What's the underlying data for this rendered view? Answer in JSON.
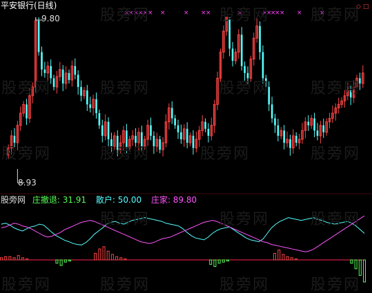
{
  "header": {
    "title": "平安银行(日线)",
    "title_color": "#ffffff"
  },
  "watermark": "股旁网",
  "price_chart": {
    "type": "candlestick",
    "high_label": "9.80",
    "low_label": "8.93",
    "up_color": "#ff4444",
    "down_color": "#55ffff",
    "markers": [
      "×",
      "◇",
      "□"
    ],
    "marker_color": "#ff44ff"
  },
  "indicator_panel": {
    "name": "股旁网",
    "items": [
      {
        "label": "庄撤退: 31.91",
        "color": "#55ff55"
      },
      {
        "label": "散户: 50.00",
        "color": "#55ffff"
      },
      {
        "label": "庄家: 89.80",
        "color": "#ff55ff"
      }
    ],
    "baseline_color": "#ff2255"
  },
  "chart_data": [
    {
      "type": "candlestick",
      "title": "平安银行(日线)",
      "annotations": [
        {
          "text": "9.80",
          "value": 9.8,
          "kind": "high"
        },
        {
          "text": "8.93",
          "value": 8.93,
          "kind": "low"
        }
      ],
      "close": [
        9.05,
        9.12,
        9.08,
        9.18,
        9.25,
        9.3,
        9.22,
        9.35,
        9.4,
        9.78,
        9.6,
        9.5,
        9.48,
        9.52,
        9.45,
        9.4,
        9.46,
        9.5,
        9.42,
        9.48,
        9.44,
        9.52,
        9.47,
        9.4,
        9.35,
        9.38,
        9.3,
        9.28,
        9.33,
        9.25,
        9.18,
        9.12,
        9.2,
        9.1,
        9.06,
        9.12,
        9.04,
        9.08,
        9.15,
        9.05,
        9.1,
        9.12,
        9.08,
        9.14,
        9.06,
        9.1,
        9.18,
        9.12,
        9.06,
        9.1,
        9.04,
        9.08,
        9.2,
        9.28,
        9.22,
        9.18,
        9.14,
        9.1,
        9.16,
        9.08,
        9.12,
        9.05,
        9.1,
        9.15,
        9.2,
        9.16,
        9.12,
        9.18,
        9.3,
        9.45,
        9.6,
        9.72,
        9.8,
        9.62,
        9.55,
        9.6,
        9.7,
        9.52,
        9.48,
        9.45,
        9.56,
        9.68,
        9.75,
        9.6,
        9.45,
        9.4,
        9.3,
        9.22,
        9.18,
        9.12,
        9.15,
        9.08,
        9.1,
        9.05,
        9.12,
        9.08,
        9.1,
        9.15,
        9.2,
        9.18,
        9.22,
        9.15,
        9.12,
        9.18,
        9.14,
        9.2,
        9.22,
        9.25,
        9.28,
        9.3,
        9.32,
        9.35,
        9.38,
        9.34,
        9.4,
        9.45,
        9.42,
        9.48
      ]
    },
    {
      "type": "line",
      "series": [
        {
          "name": "散户",
          "color": "#55ffff",
          "last": 50.0,
          "values": [
            70,
            72,
            68,
            62,
            58,
            55,
            60,
            64,
            66,
            70,
            68,
            60,
            52,
            45,
            40,
            35,
            32,
            28,
            26,
            25,
            30,
            38,
            48,
            55,
            62,
            70,
            74,
            76,
            72,
            70,
            74,
            78,
            80,
            82,
            84,
            82,
            80,
            78,
            76,
            72,
            70,
            68,
            66,
            60,
            52,
            45,
            40,
            38,
            36,
            42,
            50,
            56,
            60,
            62,
            64,
            58,
            52,
            46,
            40,
            36,
            34,
            32,
            38,
            50,
            62,
            70,
            76,
            80,
            84,
            82,
            80,
            78,
            80,
            82,
            84,
            80,
            78,
            74,
            72,
            70,
            72,
            74,
            76,
            72,
            66,
            58,
            50
          ]
        },
        {
          "name": "庄家",
          "color": "#ff55ff",
          "last": 89.8,
          "values": [
            62,
            64,
            68,
            72,
            70,
            66,
            64,
            60,
            55,
            50,
            45,
            42,
            44,
            48,
            52,
            58,
            62,
            66,
            70,
            74,
            76,
            78,
            76,
            72,
            68,
            64,
            60,
            56,
            52,
            48,
            44,
            40,
            36,
            32,
            30,
            28,
            30,
            34,
            38,
            40,
            42,
            46,
            50,
            54,
            58,
            62,
            66,
            70,
            74,
            76,
            78,
            76,
            72,
            68,
            64,
            60,
            56,
            52,
            48,
            44,
            40,
            36,
            32,
            30,
            26,
            24,
            22,
            20,
            18,
            16,
            14,
            12,
            10,
            12,
            16,
            22,
            28,
            34,
            40,
            46,
            52,
            58,
            64,
            70,
            76,
            82,
            88
          ]
        },
        {
          "name": "庄撤退",
          "type": "bar",
          "last": 31.91,
          "values": [
            2,
            3,
            3,
            2,
            4,
            2,
            1,
            0,
            0,
            0,
            0,
            0,
            0,
            -3,
            -5,
            -2,
            -1,
            0,
            0,
            0,
            0,
            0,
            6,
            10,
            12,
            8,
            5,
            3,
            2,
            1,
            0,
            0,
            0,
            0,
            0,
            0,
            0,
            0,
            0,
            0,
            0,
            0,
            0,
            0,
            0,
            0,
            0,
            0,
            0,
            -4,
            -6,
            -3,
            -2,
            -1,
            0,
            0,
            0,
            0,
            0,
            0,
            0,
            0,
            0,
            0,
            6,
            9,
            5,
            3,
            2,
            1,
            0,
            0,
            0,
            0,
            0,
            0,
            0,
            0,
            0,
            0,
            0,
            0,
            -3,
            -8,
            -14,
            -20
          ]
        }
      ]
    }
  ]
}
